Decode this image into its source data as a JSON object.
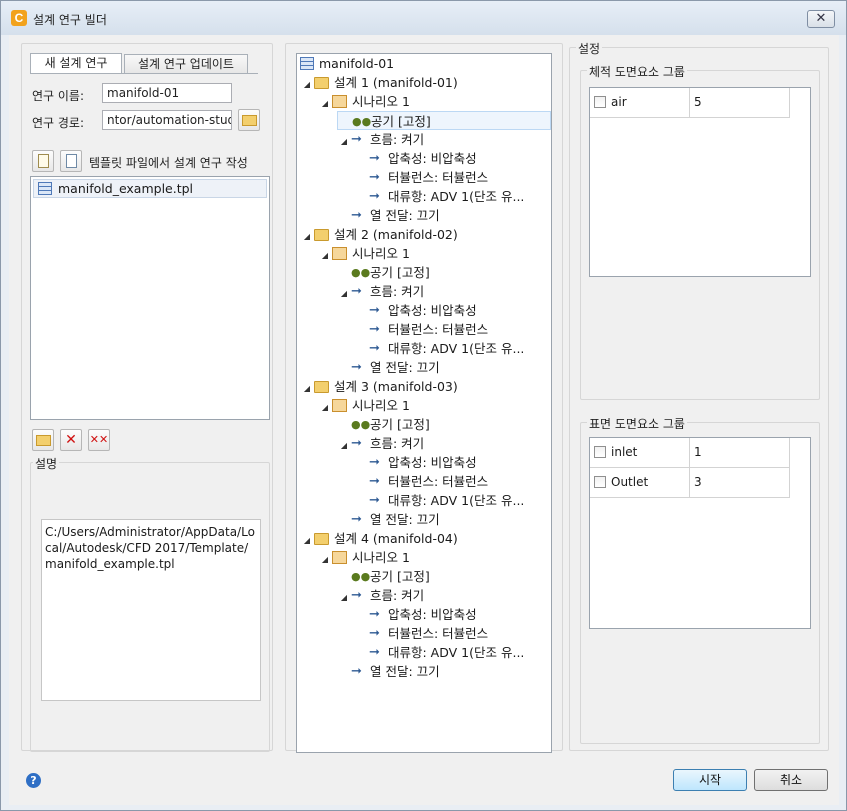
{
  "window": {
    "title": "설계 연구 빌더",
    "close_symbol": "✕"
  },
  "left": {
    "tabs": [
      {
        "label": "새 설계 연구",
        "active": true
      },
      {
        "label": "설계 연구 업데이트",
        "active": false
      }
    ],
    "study_name": {
      "label": "연구 이름:",
      "value": "manifold-01"
    },
    "study_path": {
      "label": "연구 경로:",
      "value": "ntor/automation-study"
    },
    "template_label": "템플릿 파일에서 설계 연구 작성",
    "template_files": [
      "manifold_example.tpl"
    ],
    "description": {
      "label": "설명",
      "text": "C:/Users/Administrator/AppData/Local/Autodesk/CFD 2017/Template/manifold_example.tpl"
    }
  },
  "tree": {
    "root": "manifold-01",
    "designs": [
      {
        "label": "설계 1 (manifold-01)",
        "scenario": "시나리오 1",
        "material": "공기 [고정]",
        "flow": "흐름: 켜기",
        "flow_items": [
          "압축성: 비압축성",
          "터뷸런스: 터뷸런스",
          "대류항: ADV 1(단조 유..."
        ],
        "heat": "열 전달: 끄기"
      },
      {
        "label": "설계 2 (manifold-02)",
        "scenario": "시나리오 1",
        "material": "공기 [고정]",
        "flow": "흐름: 켜기",
        "flow_items": [
          "압축성: 비압축성",
          "터뷸런스: 터뷸런스",
          "대류항: ADV 1(단조 유..."
        ],
        "heat": "열 전달: 끄기"
      },
      {
        "label": "설계 3 (manifold-03)",
        "scenario": "시나리오 1",
        "material": "공기 [고정]",
        "flow": "흐름: 켜기",
        "flow_items": [
          "압축성: 비압축성",
          "터뷸런스: 터뷸런스",
          "대류항: ADV 1(단조 유..."
        ],
        "heat": "열 전달: 끄기"
      },
      {
        "label": "설계 4 (manifold-04)",
        "scenario": "시나리오 1",
        "material": "공기 [고정]",
        "flow": "흐름: 켜기",
        "flow_items": [
          "압축성: 비압축성",
          "터뷸런스: 터뷸런스",
          "대류항: ADV 1(단조 유..."
        ],
        "heat": "열 전달: 끄기"
      }
    ]
  },
  "settings": {
    "label": "설정",
    "volume_group": {
      "label": "체적 도면요소 그룹",
      "rows": [
        {
          "name": "air",
          "value": "5"
        }
      ]
    },
    "surface_group": {
      "label": "표면 도면요소 그룹",
      "rows": [
        {
          "name": "inlet",
          "value": "1"
        },
        {
          "name": "Outlet",
          "value": "3"
        }
      ]
    }
  },
  "footer": {
    "help_symbol": "?",
    "start_label": "시작",
    "cancel_label": "취소"
  }
}
